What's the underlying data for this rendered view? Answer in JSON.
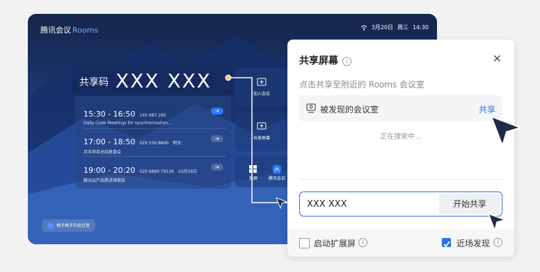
{
  "app": {
    "name": "腾讯会议",
    "product": "Rooms"
  },
  "status": {
    "date": "3月20日",
    "weekday": "周三",
    "time": "14:30"
  },
  "share_code": {
    "label": "共享码",
    "value": "XXX XXX"
  },
  "meetings": [
    {
      "time": "15:30 - 16:50",
      "id": "145 683 295",
      "title": "Daily Code Meetings for synchronization...",
      "extra": "",
      "active": true
    },
    {
      "time": "17:00 - 18:50",
      "id": "029 556 8840",
      "title": "月末项目总结复盘会",
      "extra": "明天",
      "active": false
    },
    {
      "time": "19:00 - 20:20",
      "id": "029 6880 79156",
      "title": "腾讯云产品需求排期会",
      "extra": "03月26日",
      "active": false
    }
  ],
  "side_tiles": {
    "join": "加入会议",
    "share": "共享屏幕",
    "win": "投屏",
    "tm": "腾讯会议"
  },
  "room_name": "椅子椅子的会议室",
  "dialog": {
    "title": "共享屏幕",
    "hint": "点击共享至附近的 Rooms 会议室",
    "found_label": "被发现的会议室",
    "share_action": "共享",
    "searching": "正在搜索中...",
    "code_value": "XXX XXX",
    "start_button": "开始共享",
    "ext_screen_label": "启动扩展屏",
    "ext_screen_checked": false,
    "nearby_label": "近场发现",
    "nearby_checked": true
  },
  "colors": {
    "accent": "#2a6fe6"
  }
}
